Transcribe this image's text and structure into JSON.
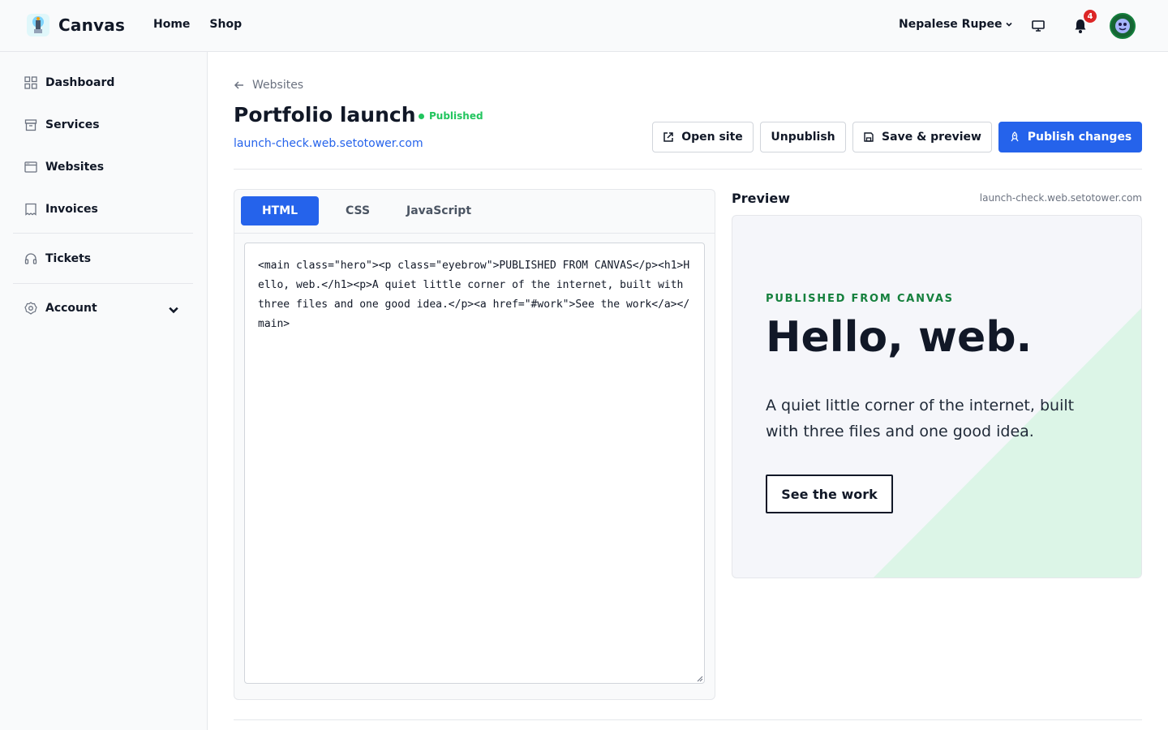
{
  "app": {
    "name": "Canvas"
  },
  "topnav": {
    "home": "Home",
    "shop": "Shop"
  },
  "header": {
    "currency": "Nepalese Rupee",
    "notification_count": "4"
  },
  "sidebar": {
    "items": [
      {
        "label": "Dashboard",
        "icon": "grid-icon"
      },
      {
        "label": "Services",
        "icon": "box-icon"
      },
      {
        "label": "Websites",
        "icon": "browser-icon"
      },
      {
        "label": "Invoices",
        "icon": "receipt-icon"
      },
      {
        "label": "Tickets",
        "icon": "headset-icon"
      },
      {
        "label": "Account",
        "icon": "gear-icon"
      }
    ]
  },
  "page": {
    "back_label": "Websites",
    "title": "Portfolio launch",
    "status": "Published",
    "url": "launch-check.web.setotower.com"
  },
  "actions": {
    "open_site": "Open site",
    "unpublish": "Unpublish",
    "save_preview": "Save & preview",
    "publish": "Publish changes"
  },
  "editor": {
    "tabs": [
      "HTML",
      "CSS",
      "JavaScript"
    ],
    "active_tab": "HTML",
    "code": "<main class=\"hero\"><p class=\"eyebrow\">PUBLISHED FROM CANVAS</p><h1>Hello, web.</h1><p>A quiet little corner of the internet, built with three files and one good idea.</p><a href=\"#work\">See the work</a></main>"
  },
  "preview": {
    "label": "Preview",
    "url": "launch-check.web.setotower.com",
    "eyebrow": "PUBLISHED FROM CANVAS",
    "title": "Hello, web.",
    "text": "A quiet little corner of the internet, built with three files and one good idea.",
    "link": "See the work"
  },
  "colors": {
    "accent": "#2563eb",
    "success": "#22c55e",
    "badge": "#dc2626",
    "preview_accent": "#15803d",
    "preview_deco": "#dcf5e7"
  }
}
